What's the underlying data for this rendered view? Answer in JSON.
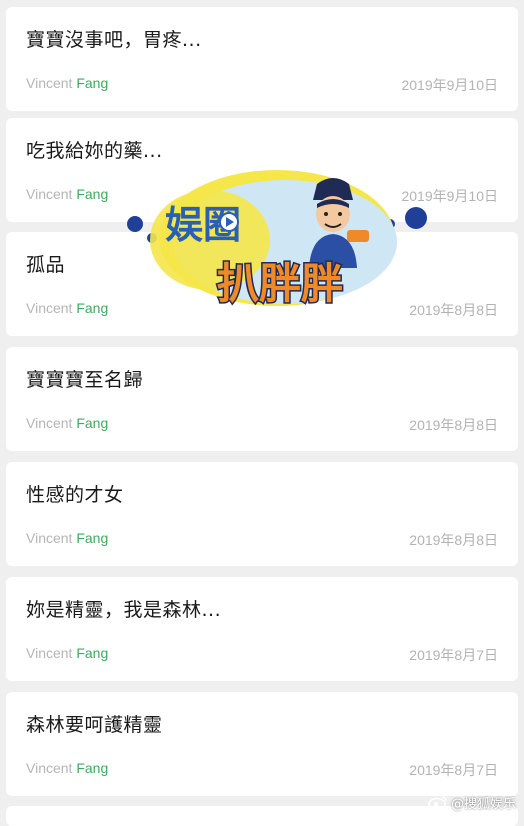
{
  "posts": [
    {
      "title": "寶寶沒事吧，胃疼...",
      "author_first": "Vincent",
      "author_last": "Fang",
      "date": "2019年9月10日"
    },
    {
      "title": "吃我給妳的藥...",
      "author_first": "Vincent",
      "author_last": "Fang",
      "date": "2019年9月10日"
    },
    {
      "title": "孤品",
      "author_first": "Vincent",
      "author_last": "Fang",
      "date": "2019年8月8日"
    },
    {
      "title": "寶寶寶至名歸",
      "author_first": "Vincent",
      "author_last": "Fang",
      "date": "2019年8月8日"
    },
    {
      "title": "性感的才女",
      "author_first": "Vincent",
      "author_last": "Fang",
      "date": "2019年8月8日"
    },
    {
      "title": "妳是精靈，我是森林...",
      "author_first": "Vincent",
      "author_last": "Fang",
      "date": "2019年8月7日"
    },
    {
      "title": "森林要呵護精靈",
      "author_first": "Vincent",
      "author_last": "Fang",
      "date": "2019年8月7日"
    }
  ],
  "watermark": {
    "logo_text_top": "娱圈",
    "logo_text_bottom": "扒胖胖",
    "weibo_label": "@搜狐娱乐",
    "icon": "weibo-icon"
  },
  "colors": {
    "background": "#efefef",
    "card": "#ffffff",
    "author_accent": "#3faa5f",
    "muted": "#b3b3b3",
    "logo_blue": "#2a5fb8",
    "logo_yellow": "#f5e64a",
    "logo_orange": "#f08a28"
  }
}
